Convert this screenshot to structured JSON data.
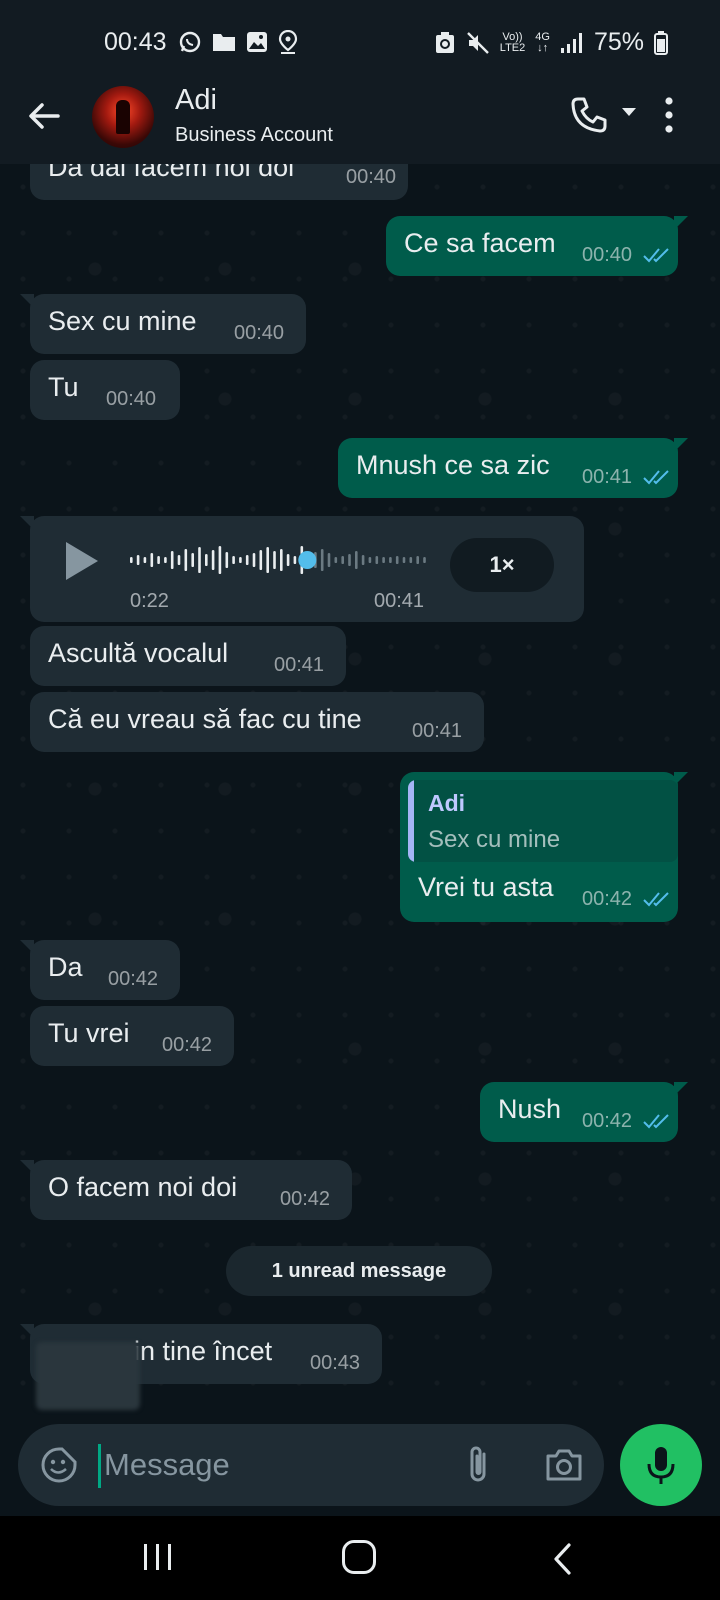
{
  "status_bar": {
    "time": "00:43",
    "battery": "75%",
    "network": "4G",
    "volte_top": "Vo))",
    "volte_bottom": "LTE2",
    "icons": [
      "whatsapp-icon",
      "folder-icon",
      "gallery-icon",
      "location-icon",
      "recycle-icon",
      "mute-icon",
      "signal-icon",
      "battery-icon"
    ]
  },
  "header": {
    "contact_name": "Adi",
    "contact_subtitle": "Business Account"
  },
  "messages": [
    {
      "direction": "in",
      "text": "Da dai facem noi doi",
      "time": "00:40"
    },
    {
      "direction": "out",
      "text": "Ce sa facem",
      "time": "00:40",
      "read": true
    },
    {
      "direction": "in",
      "text": "Sex cu mine",
      "time": "00:40"
    },
    {
      "direction": "in",
      "text": "Tu",
      "time": "00:40"
    },
    {
      "direction": "out",
      "text": "Mnush ce sa zic",
      "time": "00:41",
      "read": true
    },
    {
      "direction": "in",
      "type": "voice",
      "duration": "0:22",
      "time": "00:41",
      "speed": "1×",
      "progress": 0.58
    },
    {
      "direction": "in",
      "text": "Ascultă vocalul",
      "time": "00:41"
    },
    {
      "direction": "in",
      "text": "Că eu vreau să fac cu tine",
      "time": "00:41"
    },
    {
      "direction": "out",
      "text": "Vrei tu asta",
      "time": "00:42",
      "read": true,
      "quote": {
        "author": "Adi",
        "text": "Sex cu mine"
      }
    },
    {
      "direction": "in",
      "text": "Da",
      "time": "00:42"
    },
    {
      "direction": "in",
      "text": "Tu vrei",
      "time": "00:42"
    },
    {
      "direction": "out",
      "text": "Nush",
      "time": "00:42",
      "read": true
    },
    {
      "direction": "in",
      "text": "O facem noi doi",
      "time": "00:42"
    },
    {
      "direction": "in",
      "text": "in tine încet",
      "time": "00:43"
    }
  ],
  "unread_banner": "1 unread message",
  "composer": {
    "placeholder": "Message"
  },
  "colors": {
    "incoming_bubble": "#1f2c34",
    "outgoing_bubble": "#005c4b",
    "accent": "#21c063",
    "read_ticks": "#53bdeb"
  }
}
